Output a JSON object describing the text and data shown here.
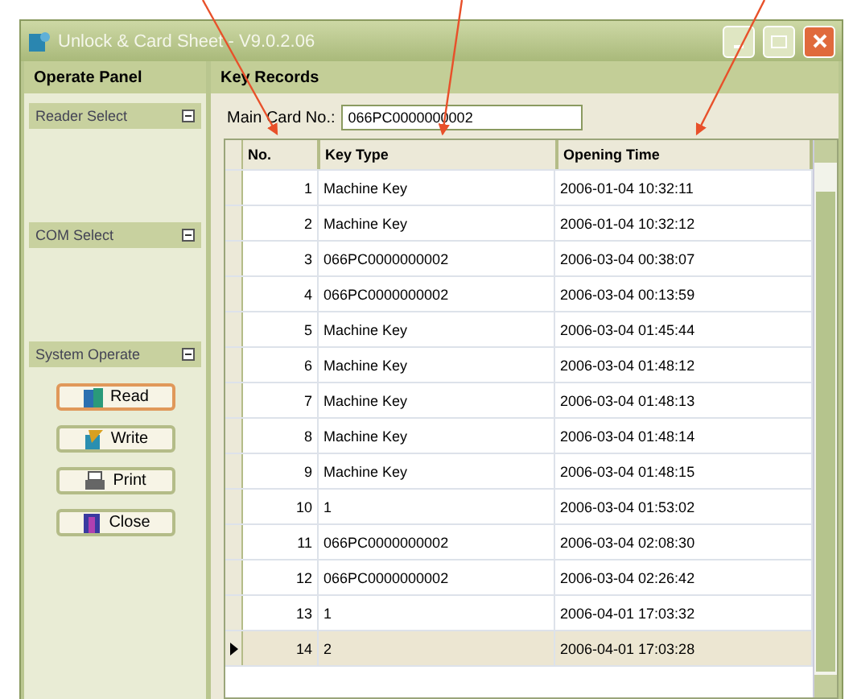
{
  "window": {
    "title": "Unlock & Card Sheet - V9.0.2.06"
  },
  "operate_panel": {
    "title": "Operate Panel",
    "sections": [
      {
        "title": "Reader Select",
        "expanded": true
      },
      {
        "title": "COM Select",
        "expanded": true
      },
      {
        "title": "System Operate",
        "expanded": true
      }
    ],
    "buttons": [
      {
        "label": "Read",
        "kind": "read",
        "focused": true
      },
      {
        "label": "Write",
        "kind": "write",
        "focused": false
      },
      {
        "label": "Print",
        "kind": "print",
        "focused": false
      },
      {
        "label": "Close",
        "kind": "close",
        "focused": false
      }
    ]
  },
  "records": {
    "title": "Key Records",
    "main_card": {
      "label": "Main Card No.:",
      "value": "066PC0000000002"
    },
    "table": {
      "columns": [
        "No.",
        "Key Type",
        "Opening Time"
      ],
      "rows": [
        {
          "cells": [
            "1",
            "Machine Key",
            "2006-01-04 10:32:11"
          ],
          "selected": false
        },
        {
          "cells": [
            "2",
            "Machine Key",
            "2006-01-04 10:32:12"
          ],
          "selected": false
        },
        {
          "cells": [
            "3",
            "066PC0000000002",
            "2006-03-04 00:38:07"
          ],
          "selected": false
        },
        {
          "cells": [
            "4",
            "066PC0000000002",
            "2006-03-04 00:13:59"
          ],
          "selected": false
        },
        {
          "cells": [
            "5",
            "Machine Key",
            "2006-03-04 01:45:44"
          ],
          "selected": false
        },
        {
          "cells": [
            "6",
            "Machine Key",
            "2006-03-04 01:48:12"
          ],
          "selected": false
        },
        {
          "cells": [
            "7",
            "Machine Key",
            "2006-03-04 01:48:13"
          ],
          "selected": false
        },
        {
          "cells": [
            "8",
            "Machine Key",
            "2006-03-04 01:48:14"
          ],
          "selected": false
        },
        {
          "cells": [
            "9",
            "Machine Key",
            "2006-03-04 01:48:15"
          ],
          "selected": false
        },
        {
          "cells": [
            "10",
            "1",
            "2006-03-04 01:53:02"
          ],
          "selected": false
        },
        {
          "cells": [
            "11",
            "066PC0000000002",
            "2006-03-04 02:08:30"
          ],
          "selected": false
        },
        {
          "cells": [
            "12",
            "066PC0000000002",
            "2006-03-04 02:26:42"
          ],
          "selected": false
        },
        {
          "cells": [
            "13",
            "1",
            "2006-04-01 17:03:32"
          ],
          "selected": false
        },
        {
          "cells": [
            "14",
            "2",
            "2006-04-01 17:03:28"
          ],
          "selected": true
        }
      ]
    }
  }
}
